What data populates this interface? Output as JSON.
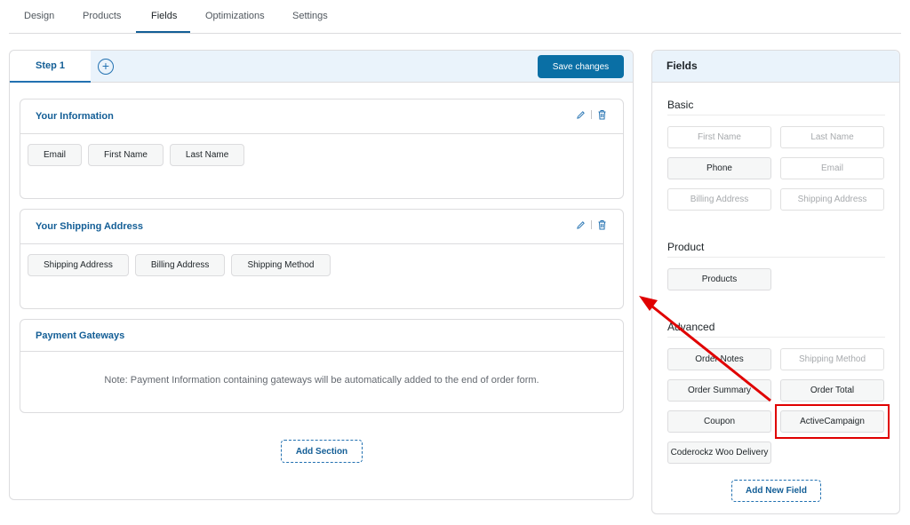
{
  "topnav": {
    "tabs": [
      "Design",
      "Products",
      "Fields",
      "Optimizations",
      "Settings"
    ],
    "active": "Fields"
  },
  "builder": {
    "step_label": "Step 1",
    "add_step_symbol": "+",
    "save_label": "Save changes",
    "sections": [
      {
        "title": "Your Information",
        "fields": [
          "Email",
          "First Name",
          "Last Name"
        ]
      },
      {
        "title": "Your Shipping Address",
        "fields": [
          "Shipping Address",
          "Billing Address",
          "Shipping Method"
        ]
      },
      {
        "title": "Payment Gateways",
        "note": "Note: Payment Information containing gateways will be automatically added to the end of order form."
      }
    ],
    "add_section_label": "Add Section"
  },
  "sidebar": {
    "title": "Fields",
    "groups": [
      {
        "title": "Basic",
        "items": [
          {
            "label": "First Name",
            "enabled": false
          },
          {
            "label": "Last Name",
            "enabled": false
          },
          {
            "label": "Phone",
            "enabled": true
          },
          {
            "label": "Email",
            "enabled": false
          },
          {
            "label": "Billing Address",
            "enabled": false
          },
          {
            "label": "Shipping Address",
            "enabled": false
          }
        ]
      },
      {
        "title": "Product",
        "items": [
          {
            "label": "Products",
            "enabled": true
          }
        ]
      },
      {
        "title": "Advanced",
        "items": [
          {
            "label": "Order Notes",
            "enabled": true
          },
          {
            "label": "Shipping Method",
            "enabled": false
          },
          {
            "label": "Order Summary",
            "enabled": true
          },
          {
            "label": "Order Total",
            "enabled": true
          },
          {
            "label": "Coupon",
            "enabled": true
          },
          {
            "label": "ActiveCampaign",
            "enabled": true
          },
          {
            "label": "Coderockz Woo Delivery",
            "enabled": true
          }
        ]
      }
    ],
    "add_field_label": "Add New Field"
  },
  "colors": {
    "accent": "#2271b1",
    "save_button": "#0a6fa5",
    "annotation": "#e00000",
    "header_bg": "#eaf3fb"
  },
  "icons": [
    "plus-circle-icon",
    "pencil-icon",
    "trash-icon",
    "annotation-arrow"
  ]
}
